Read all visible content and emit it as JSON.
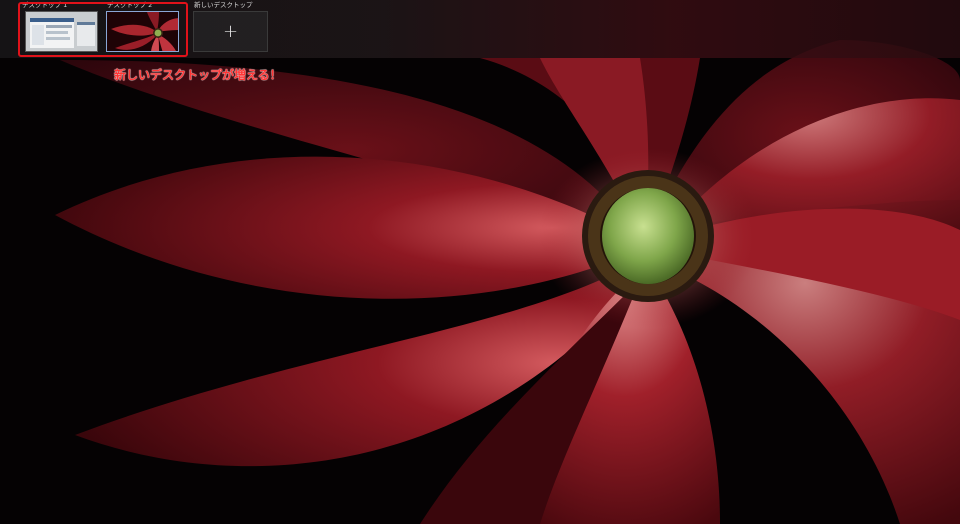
{
  "task_view": {
    "desktops": [
      {
        "label": "デスクトップ 1",
        "thumbnail": "desktop-1-windows-preview"
      },
      {
        "label": "デスクトップ 2",
        "thumbnail": "red-flower-wallpaper-preview",
        "active": true
      }
    ],
    "new_desktop": {
      "label": "新しいデスクトップ",
      "icon": "plus-icon",
      "symbol": "+"
    }
  },
  "annotation": {
    "text": "新しいデスクトップが増える！",
    "color": "#e0121a"
  },
  "wallpaper": {
    "subject": "red-flower",
    "colors": {
      "petal": "#8a1620",
      "center": "#7fa64a",
      "background": "#050203"
    }
  }
}
